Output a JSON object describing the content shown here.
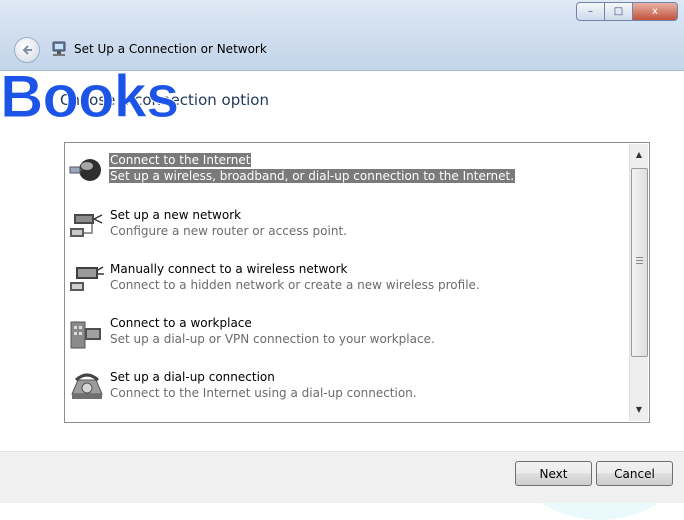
{
  "window": {
    "title": "Set Up a Connection or Network",
    "controls": {
      "minimize": "–",
      "maximize": "□",
      "close": "x"
    },
    "back_icon": "back-arrow-icon"
  },
  "watermark": "Books",
  "heading": "Choose a connection option",
  "options": [
    {
      "title": "Connect to the Internet",
      "description": "Set up a wireless, broadband, or dial-up connection to the Internet.",
      "icon": "globe-network-icon",
      "selected": true
    },
    {
      "title": "Set up a new network",
      "description": "Configure a new router or access point.",
      "icon": "router-network-icon",
      "selected": false
    },
    {
      "title": "Manually connect to a wireless network",
      "description": "Connect to a hidden network or create a new wireless profile.",
      "icon": "wireless-network-icon",
      "selected": false
    },
    {
      "title": "Connect to a workplace",
      "description": "Set up a dial-up or VPN connection to your workplace.",
      "icon": "workplace-building-icon",
      "selected": false
    },
    {
      "title": "Set up a dial-up connection",
      "description": "Connect to the Internet using a dial-up connection.",
      "icon": "dialup-phone-icon",
      "selected": false
    }
  ],
  "scrollbar": {
    "up": "▲",
    "down": "▼"
  },
  "buttons": {
    "next": "Next",
    "cancel": "Cancel"
  },
  "colors": {
    "selection": "#7a7a7a",
    "heading": "#1e395b",
    "watermark": "#1d54e8"
  }
}
